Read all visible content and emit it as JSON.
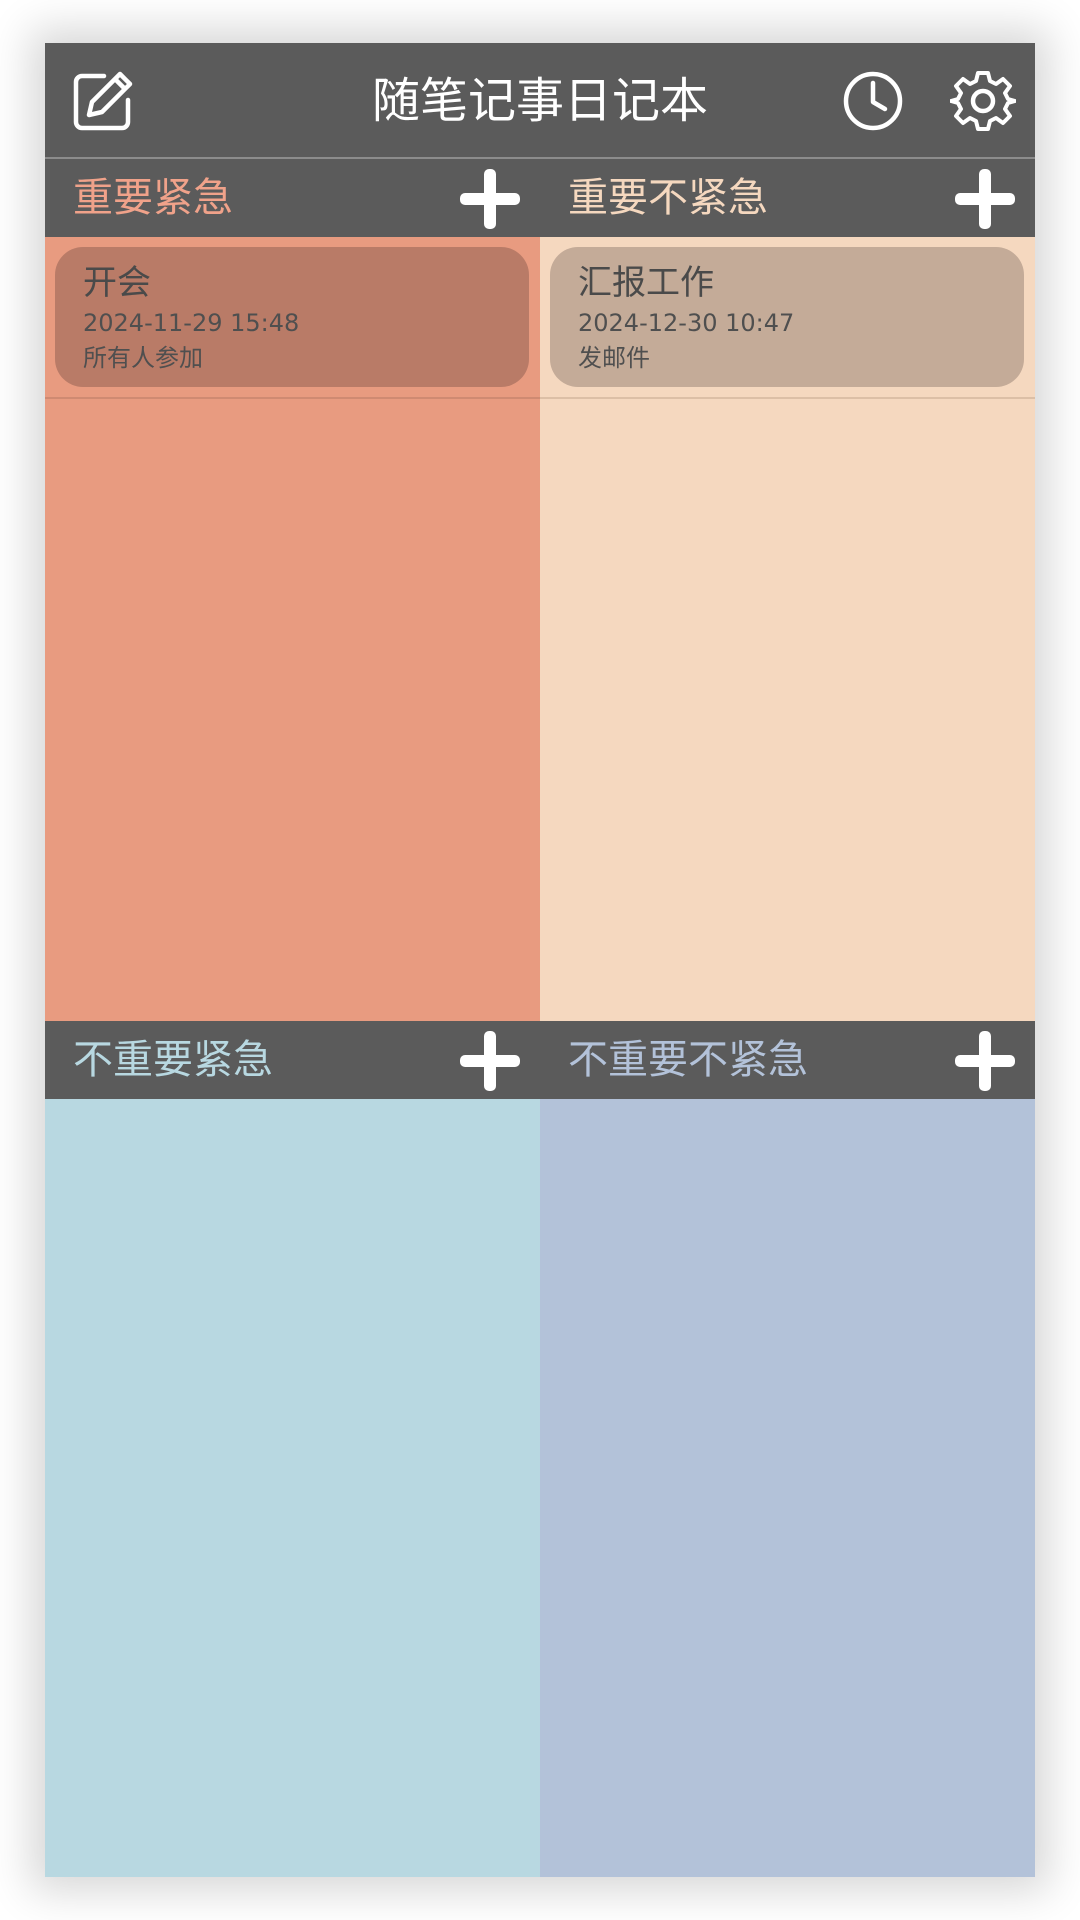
{
  "app": {
    "title": "随笔记事日记本",
    "icons": {
      "edit": "edit-note-icon",
      "history": "clock-icon",
      "settings": "gear-icon",
      "add": "plus-icon"
    }
  },
  "quadrants": [
    {
      "title": "重要紧急",
      "title_color": "#f0a28a",
      "bg_color": "#e89b80",
      "notes": [
        {
          "title": "开会",
          "time": "2024-11-29 15:48",
          "desc": "所有人参加"
        }
      ]
    },
    {
      "title": "重要不紧急",
      "title_color": "#f5d8bf",
      "bg_color": "#f5d8bf",
      "notes": [
        {
          "title": "汇报工作",
          "time": "2024-12-30 10:47",
          "desc": "发邮件"
        }
      ]
    },
    {
      "title": "不重要紧急",
      "title_color": "#b8d8e1",
      "bg_color": "#b8d8e1",
      "notes": []
    },
    {
      "title": "不重要不紧急",
      "title_color": "#b3c2d9",
      "bg_color": "#b3c2d9",
      "notes": []
    }
  ],
  "colors": {
    "toolbar": "#5b5b5b",
    "icon": "#ffffff"
  }
}
